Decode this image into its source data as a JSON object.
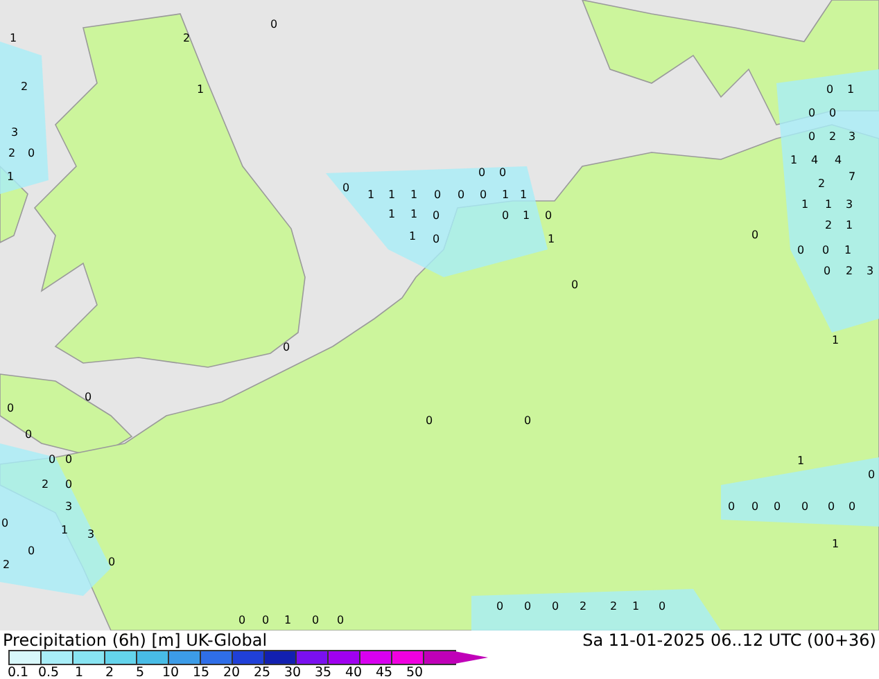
{
  "map": {
    "values": [
      "0",
      "1",
      "2",
      "2",
      "1",
      "0",
      "1",
      "0",
      "0",
      "3",
      "0",
      "2",
      "3",
      "2",
      "0",
      "1",
      "4",
      "4",
      "1",
      "0",
      "0",
      "7",
      "0",
      "2",
      "1",
      "1",
      "1",
      "0",
      "0",
      "0",
      "1",
      "1",
      "1",
      "1",
      "3",
      "1",
      "1",
      "0",
      "0",
      "1",
      "0",
      "2",
      "1",
      "1",
      "0",
      "1",
      "0",
      "0",
      "0",
      "1",
      "0",
      "2",
      "3",
      "0",
      "1",
      "0",
      "0",
      "0",
      "0",
      "0",
      "0",
      "0",
      "0",
      "1",
      "0",
      "2",
      "0",
      "3",
      "0",
      "0",
      "0",
      "0",
      "0",
      "0",
      "0",
      "1",
      "3",
      "1",
      "0",
      "2",
      "0",
      "0",
      "0",
      "0",
      "2",
      "2",
      "1",
      "0",
      "0",
      "0",
      "1",
      "0",
      "0"
    ]
  },
  "legend": {
    "title": "Precipitation (6h) [m] UK-Global",
    "date": "Sa 11-01-2025 06..12 UTC (00+36)",
    "scale": [
      {
        "label": "0.1",
        "color": "#d8f8fb"
      },
      {
        "label": "0.5",
        "color": "#a8eef8"
      },
      {
        "label": "1",
        "color": "#88e4f2"
      },
      {
        "label": "2",
        "color": "#64d4ec"
      },
      {
        "label": "5",
        "color": "#48bce6"
      },
      {
        "label": "10",
        "color": "#3c9ce8"
      },
      {
        "label": "15",
        "color": "#2f6ee8"
      },
      {
        "label": "20",
        "color": "#2040d8"
      },
      {
        "label": "25",
        "color": "#1220b0"
      },
      {
        "label": "30",
        "color": "#7a10f0"
      },
      {
        "label": "35",
        "color": "#a000f0"
      },
      {
        "label": "40",
        "color": "#d800f0"
      },
      {
        "label": "45",
        "color": "#f000e0"
      },
      {
        "label": "50",
        "color": "#c000b8"
      }
    ]
  }
}
